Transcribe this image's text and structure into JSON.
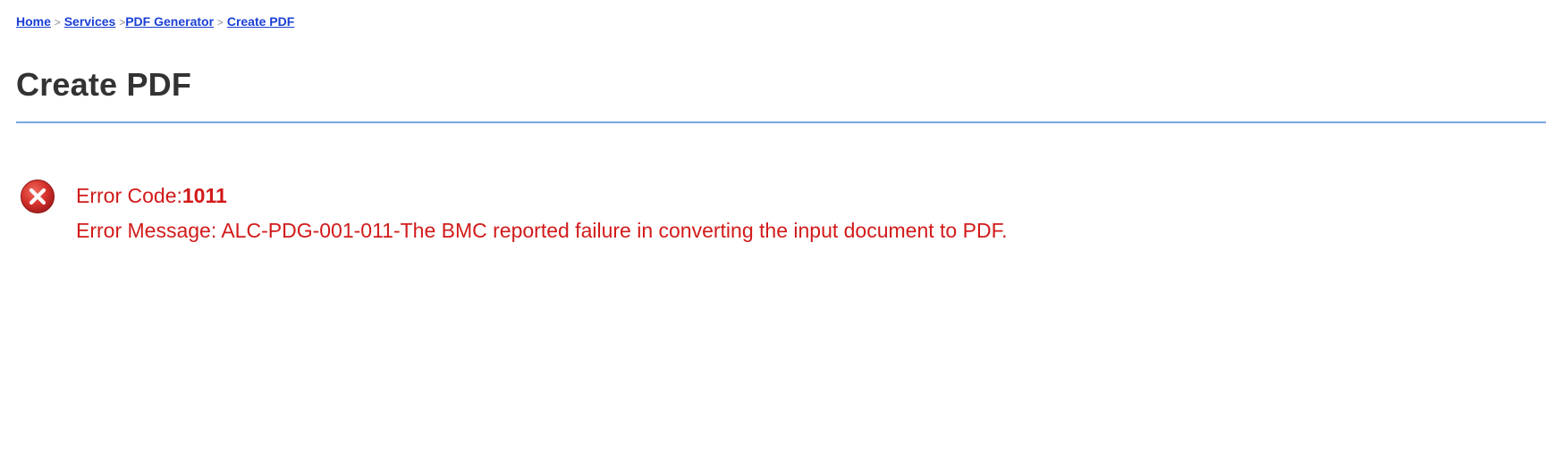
{
  "breadcrumb": {
    "items": [
      {
        "label": "Home"
      },
      {
        "label": "Services"
      },
      {
        "label": "PDF Generator"
      },
      {
        "label": "Create PDF"
      }
    ],
    "separator": ">"
  },
  "page": {
    "title": "Create PDF"
  },
  "error": {
    "icon": "error-x-icon",
    "code_label": "Error Code:",
    "code_value": "1011",
    "message_label": "Error Message: ",
    "message_value": "ALC-PDG-001-011-The BMC reported failure in converting the input document to PDF."
  },
  "colors": {
    "link": "#1a3fd6",
    "title": "#333333",
    "rule": "#7aa6e0",
    "error_text": "#d21a1a",
    "error_icon": "#c0262a"
  }
}
